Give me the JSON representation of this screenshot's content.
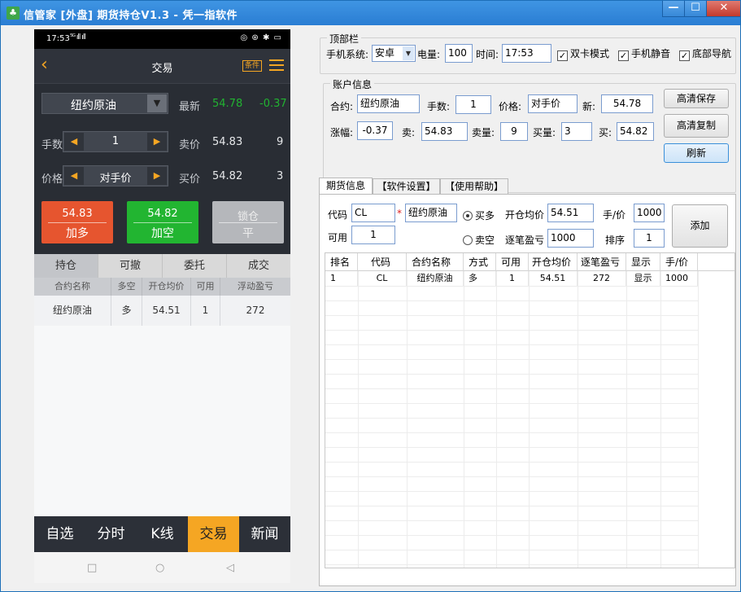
{
  "window": {
    "title": "信管家 [外盘] 期货持仓V1.3 - 凭一指软件",
    "min": "—",
    "max": "☐",
    "close": "✕"
  },
  "phone": {
    "status_time": "17:53",
    "status_signal": "⁵ᴳ ıll ıll",
    "status_right": "◎ ⊛ ✱ ▭",
    "nav_title": "交易",
    "nav_cond": "条件",
    "contract": "纽约原油",
    "latest_label": "最新",
    "latest_price": "54.78",
    "latest_change": "-0.37",
    "qty_label": "手数",
    "qty_value": "1",
    "sell_label": "卖价",
    "sell_price": "54.83",
    "sell_qty": "9",
    "price_label": "价格",
    "price_value": "对手价",
    "buy_label": "买价",
    "buy_price": "54.82",
    "buy_qty": "3",
    "btn_long": {
      "price": "54.83",
      "label": "加多"
    },
    "btn_short": {
      "price": "54.82",
      "label": "加空"
    },
    "btn_lock": {
      "top": "锁仓",
      "bottom": "平"
    },
    "tabs": [
      "持仓",
      "可撤",
      "委托",
      "成交"
    ],
    "table_headers": [
      "合约名称",
      "多空",
      "开仓均价",
      "可用",
      "浮动盈亏"
    ],
    "table_rows": [
      [
        "纽约原油",
        "多",
        "54.51",
        "1",
        "272"
      ]
    ],
    "bottom_nav": [
      "自选",
      "分时",
      "K线",
      "交易",
      "新闻"
    ],
    "sys_nav": [
      "□",
      "○",
      "◁"
    ]
  },
  "top_group": {
    "title": "顶部栏",
    "os_label": "手机系统:",
    "os_value": "安卓",
    "battery_label": "电量:",
    "battery_value": "100",
    "time_label": "时间:",
    "time_value": "17:53",
    "dual_sim": "双卡模式",
    "silent": "手机静音",
    "bottom_nav": "底部导航"
  },
  "account_group": {
    "title": "账户信息",
    "contract_label": "合约:",
    "contract_value": "纽约原油",
    "qty_label": "手数:",
    "qty_value": "1",
    "price_label": "价格:",
    "price_value": "对手价",
    "new_label": "新:",
    "new_value": "54.78",
    "change_label": "涨幅:",
    "change_value": "-0.37",
    "sell_label": "卖:",
    "sell_value": "54.83",
    "sell_qty_label": "卖量:",
    "sell_qty_value": "9",
    "buy_qty_label": "买量:",
    "buy_qty_value": "3",
    "buy_label": "买:",
    "buy_value": "54.82",
    "save_btn": "高清保存",
    "copy_btn": "高清复制",
    "refresh_btn": "刷新"
  },
  "tabs": [
    "期货信息",
    "【软件设置】",
    "【使用帮助】"
  ],
  "futures": {
    "code_label": "代码",
    "code_value": "CL",
    "required_mark": "*",
    "name_value": "纽约原油",
    "radio_buy": "买多",
    "radio_sell": "卖空",
    "avg_label": "开仓均价",
    "avg_value": "54.51",
    "unit_label": "手/价",
    "unit_value": "1000",
    "avail_label": "可用",
    "avail_value": "1",
    "pnl_label": "逐笔盈亏",
    "pnl_value": "1000",
    "sort_label": "排序",
    "sort_value": "1",
    "add_btn": "添加",
    "grid_headers": [
      "排名",
      "代码",
      "合约名称",
      "方式",
      "可用",
      "开仓均价",
      "逐笔盈亏",
      "显示",
      "手/价"
    ],
    "grid_rows": [
      [
        "1",
        "CL",
        "纽约原油",
        "多",
        "1",
        "54.51",
        "272",
        "显示",
        "1000"
      ]
    ]
  },
  "colors": {
    "accent": "#f5a623",
    "green": "#21b331",
    "long": "#e6552f",
    "short": "#22b531",
    "lock": "#b5b7bb"
  }
}
